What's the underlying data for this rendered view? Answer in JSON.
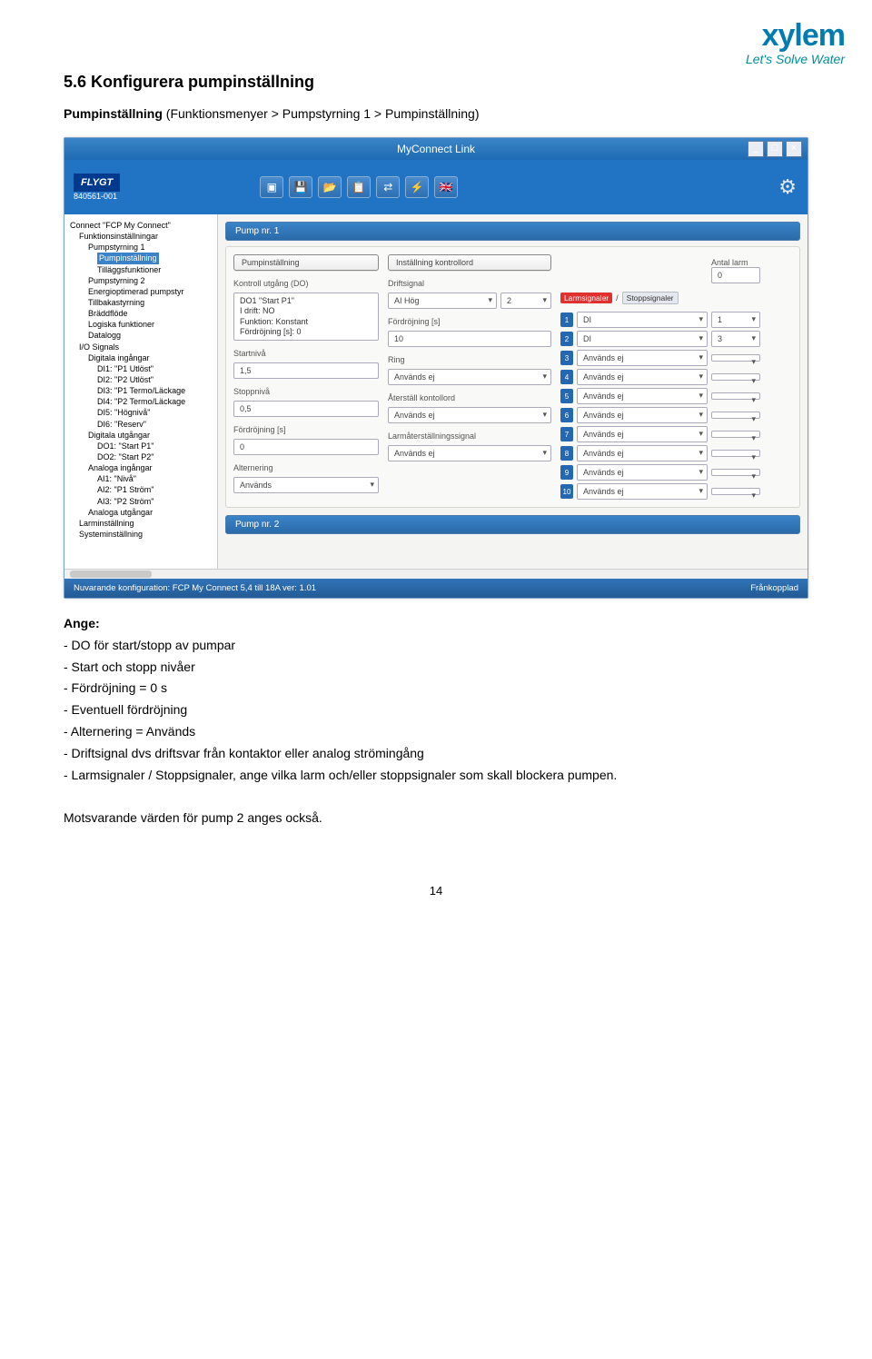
{
  "logo": {
    "brand": "xylem",
    "tagline": "Let's Solve Water"
  },
  "section": {
    "heading": "5.6 Konfigurera pumpinställning",
    "subtitle_bold": "Pumpinställning",
    "subtitle_rest": " (Funktionsmenyer > Pumpstyrning 1 > Pumpinställning)"
  },
  "app": {
    "title": "MyConnect Link",
    "flygt": "FLYGT",
    "id": "840561-001",
    "gear": "⚙"
  },
  "sidebar": {
    "items": [
      {
        "lvl": 0,
        "label": "Connect \"FCP My Connect\""
      },
      {
        "lvl": 1,
        "label": "Funktionsinställningar"
      },
      {
        "lvl": 2,
        "label": "Pumpstyrning 1"
      },
      {
        "lvl": 3,
        "label": "Pumpinställning",
        "hl": true
      },
      {
        "lvl": 3,
        "label": "Tilläggsfunktioner"
      },
      {
        "lvl": 2,
        "label": "Pumpstyrning 2"
      },
      {
        "lvl": 2,
        "label": "Energioptimerad pumpstyr"
      },
      {
        "lvl": 2,
        "label": "Tillbakastyrning"
      },
      {
        "lvl": 2,
        "label": "Bräddflöde"
      },
      {
        "lvl": 2,
        "label": "Logiska funktioner"
      },
      {
        "lvl": 2,
        "label": "Datalogg"
      },
      {
        "lvl": 1,
        "label": "I/O Signals"
      },
      {
        "lvl": 2,
        "label": "Digitala ingångar"
      },
      {
        "lvl": 3,
        "label": "DI1: \"P1 Utlöst\""
      },
      {
        "lvl": 3,
        "label": "DI2: \"P2 Utlöst\""
      },
      {
        "lvl": 3,
        "label": "DI3: \"P1 Termo/Läckage"
      },
      {
        "lvl": 3,
        "label": "DI4: \"P2 Termo/Läckage"
      },
      {
        "lvl": 3,
        "label": "DI5: \"Högnivå\""
      },
      {
        "lvl": 3,
        "label": "DI6: \"Reserv\""
      },
      {
        "lvl": 2,
        "label": "Digitala utgångar"
      },
      {
        "lvl": 3,
        "label": "DO1: \"Start P1\""
      },
      {
        "lvl": 3,
        "label": "DO2: \"Start P2\""
      },
      {
        "lvl": 2,
        "label": "Analoga ingångar"
      },
      {
        "lvl": 3,
        "label": "AI1: \"Nivå\""
      },
      {
        "lvl": 3,
        "label": "AI2: \"P1 Ström\""
      },
      {
        "lvl": 3,
        "label": "AI3: \"P2 Ström\""
      },
      {
        "lvl": 2,
        "label": "Analoga utgångar"
      },
      {
        "lvl": 1,
        "label": "Larminställning"
      },
      {
        "lvl": 1,
        "label": "Systeminställning"
      }
    ]
  },
  "pump1": {
    "header": "Pump nr. 1",
    "col1": {
      "btn": "Pumpinställning",
      "kontroll_label": "Kontroll utgång (DO)",
      "readout": "DO1 \"Start P1\"\nI drift: NO\nFunktion: Konstant\nFördröjning [s]: 0",
      "startniva_label": "Startnivå",
      "startniva": "1,5",
      "stoppniva_label": "Stoppnivå",
      "stoppniva": "0,5",
      "delay_label": "Fördröjning [s]",
      "delay": "0",
      "alt_label": "Alternering",
      "alt_value": "Används"
    },
    "col2": {
      "btn": "Inställning kontrollord",
      "drift_label": "Driftsignal",
      "drift_value": "AI Hög",
      "drift_num": "2",
      "delay_label": "Fördröjning [s]",
      "delay_value": "10",
      "ring_label": "Ring",
      "ring_value": "Används ej",
      "restore_label": "Återställ kontollord",
      "restore_value": "Används ej",
      "larmrestore_label": "Larmåterställningssignal",
      "larmrestore_value": "Används ej"
    },
    "col3": {
      "antal_label": "Antal larm",
      "antal_value": "0",
      "larm_label": "Larmsignaler",
      "stopp_label": "Stoppsignaler",
      "rows": [
        {
          "n": "1",
          "d1": "DI",
          "d2": "1"
        },
        {
          "n": "2",
          "d1": "DI",
          "d2": "3"
        },
        {
          "n": "3",
          "d1": "Används ej",
          "d2": ""
        },
        {
          "n": "4",
          "d1": "Används ej",
          "d2": ""
        },
        {
          "n": "5",
          "d1": "Används ej",
          "d2": ""
        },
        {
          "n": "6",
          "d1": "Används ej",
          "d2": ""
        },
        {
          "n": "7",
          "d1": "Används ej",
          "d2": ""
        },
        {
          "n": "8",
          "d1": "Används ej",
          "d2": ""
        },
        {
          "n": "9",
          "d1": "Används ej",
          "d2": ""
        },
        {
          "n": "10",
          "d1": "Används ej",
          "d2": ""
        }
      ]
    }
  },
  "pump2": {
    "header": "Pump nr. 2"
  },
  "statusbar": {
    "left": "Nuvarande konfiguration:  FCP My Connect 5,4 till 18A ver: 1.01",
    "right": "Frånkopplad"
  },
  "after": {
    "ange": "Ange:",
    "lines": [
      "- DO för start/stopp av pumpar",
      "- Start och stopp nivåer",
      "- Fördröjning = 0 s",
      "- Eventuell fördröjning",
      "- Alternering = Används",
      "- Driftsignal  dvs driftsvar från kontaktor eller analog strömingång",
      "- Larmsignaler / Stoppsignaler, ange vilka larm och/eller stoppsignaler som skall blockera pumpen."
    ],
    "note": "Motsvarande värden för pump 2 anges också."
  },
  "page_number": "14"
}
